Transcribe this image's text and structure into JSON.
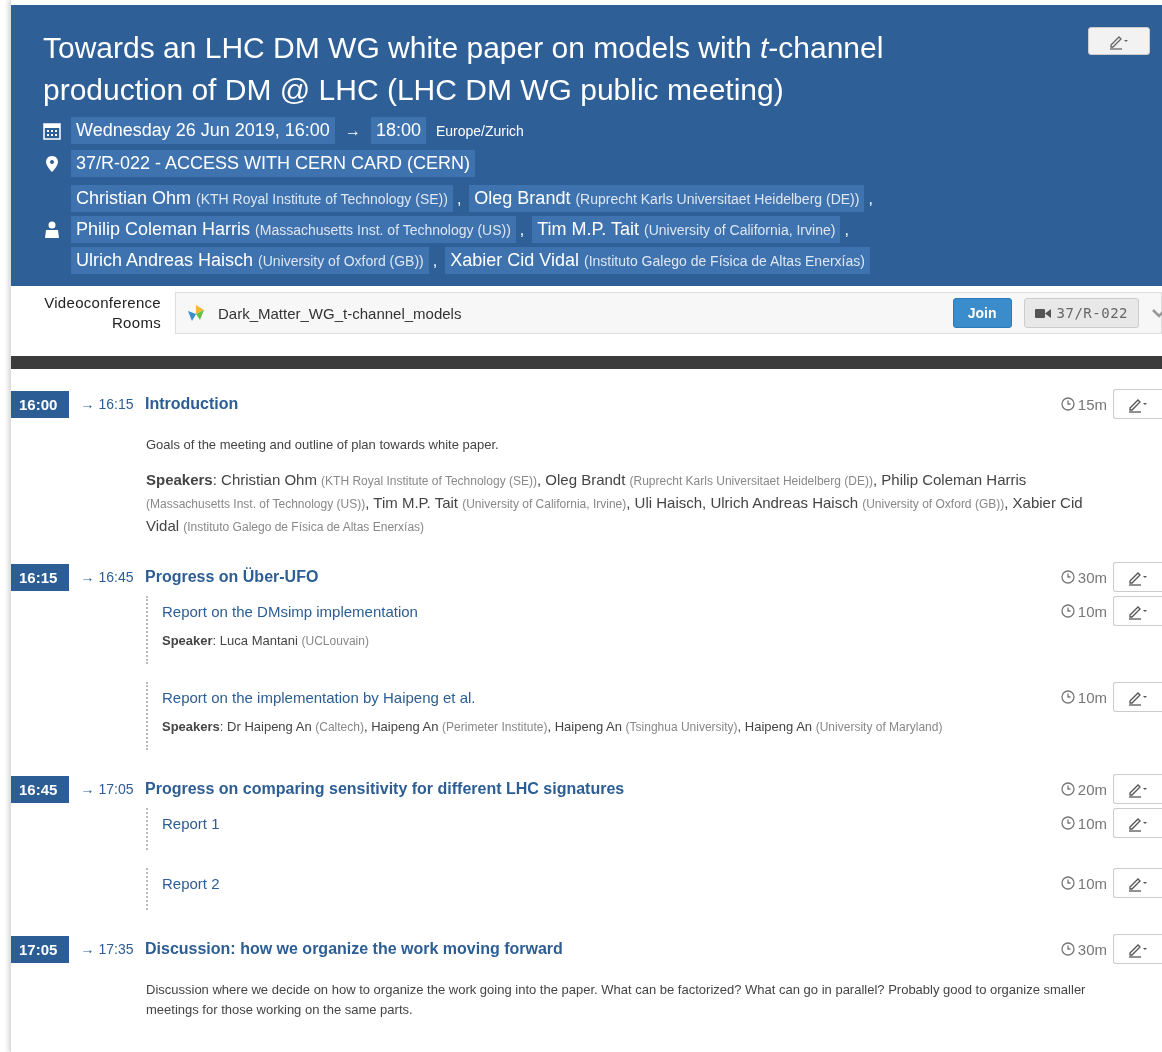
{
  "event": {
    "title": "Towards an LHC DM WG white paper on models with *t*-channel production of DM @ LHC (LHC DM WG public meeting)",
    "date": {
      "start": "Wednesday 26 Jun 2019, 16:00",
      "arrow": "→",
      "end": "18:00",
      "timezone": "Europe/Zurich"
    },
    "location": "37/R-022 - ACCESS WITH CERN CARD (CERN)",
    "people_lines": [
      [
        {
          "name": "Christian Ohm",
          "affiliation": "(KTH Royal Institute of Technology (SE))",
          "sep": ","
        },
        {
          "name": "Oleg Brandt",
          "affiliation": "(Ruprecht Karls Universitaet Heidelberg (DE))",
          "sep": ","
        }
      ],
      [
        {
          "name": "Philip Coleman Harris",
          "affiliation": "(Massachusetts Inst. of Technology (US))",
          "sep": ","
        },
        {
          "name": "Tim M.P. Tait",
          "affiliation": "(University of California, Irvine)",
          "sep": ","
        }
      ],
      [
        {
          "name": "Ulrich Andreas Haisch",
          "affiliation": "(University of Oxford (GB))",
          "sep": ","
        },
        {
          "name": "Xabier Cid Vidal",
          "affiliation": "(Instituto Galego de Física de Altas Enerxías)"
        }
      ]
    ]
  },
  "videoconference": {
    "label": "Videoconference Rooms",
    "room_name": "Dark_Matter_WG_t-channel_models",
    "join": "Join",
    "room": "37/R-022"
  },
  "agenda": [
    {
      "start": "16:00",
      "end": "→ 16:15",
      "title": "Introduction",
      "duration": "15m",
      "description": "Goals of the meeting and outline of plan towards white paper.",
      "speakers": {
        "label": "**Speakers**:",
        "people": [
          {
            "name": "Christian Ohm",
            "affiliation": "(KTH Royal Institute of Technology (SE))",
            "sep": ","
          },
          {
            "name": "Oleg Brandt",
            "affiliation": "(Ruprecht Karls Universitaet Heidelberg (DE))",
            "sep": ","
          },
          {
            "name": "Philip Coleman Harris",
            "affiliation": "(Massachusetts Inst. of Technology (US))",
            "sep": ","
          },
          {
            "name": "Tim M.P. Tait",
            "affiliation": "(University of California, Irvine)",
            "sep": ","
          },
          {
            "name": "Uli Haisch",
            "sep": ","
          },
          {
            "name": "Ulrich Andreas Haisch",
            "affiliation": "(University of Oxford (GB))",
            "sep": ","
          },
          {
            "name": "Xabier Cid Vidal",
            "affiliation": "(Instituto Galego de Física de Altas Enerxías)"
          }
        ]
      }
    },
    {
      "start": "16:15",
      "end": "→ 16:45",
      "title": "Progress on Über-UFO",
      "duration": "30m",
      "children": [
        {
          "title": "Report on the DMsimp implementation",
          "duration": "10m",
          "speakers": {
            "label": "**Speaker**:",
            "people": [
              {
                "name": "Luca Mantani",
                "affiliation": "(UCLouvain)"
              }
            ]
          }
        },
        {
          "title": "Report on the implementation by Haipeng et al.",
          "duration": "10m",
          "speakers": {
            "label": "**Speakers**:",
            "people": [
              {
                "name": "Dr Haipeng An",
                "affiliation": "(Caltech)",
                "sep": ","
              },
              {
                "name": "Haipeng An",
                "affiliation": "(Perimeter Institute)",
                "sep": ","
              },
              {
                "name": "Haipeng An",
                "affiliation": "(Tsinghua University)",
                "sep": ","
              },
              {
                "name": "Haipeng An",
                "affiliation": "(University of Maryland)"
              }
            ]
          }
        }
      ]
    },
    {
      "start": "16:45",
      "end": "→ 17:05",
      "title": "Progress on comparing sensitivity for different LHC signatures",
      "duration": "20m",
      "children": [
        {
          "title": "Report 1",
          "duration": "10m"
        },
        {
          "title": "Report 2",
          "duration": "10m"
        }
      ]
    },
    {
      "start": "17:05",
      "end": "→ 17:35",
      "title": "Discussion: how we organize the work moving forward",
      "duration": "30m",
      "description": "Discussion where we decide on how to organize the work going into the paper. What can be factorized? What can go in parallel? Probably good to organize smaller meetings for those working on the same parts."
    }
  ]
}
